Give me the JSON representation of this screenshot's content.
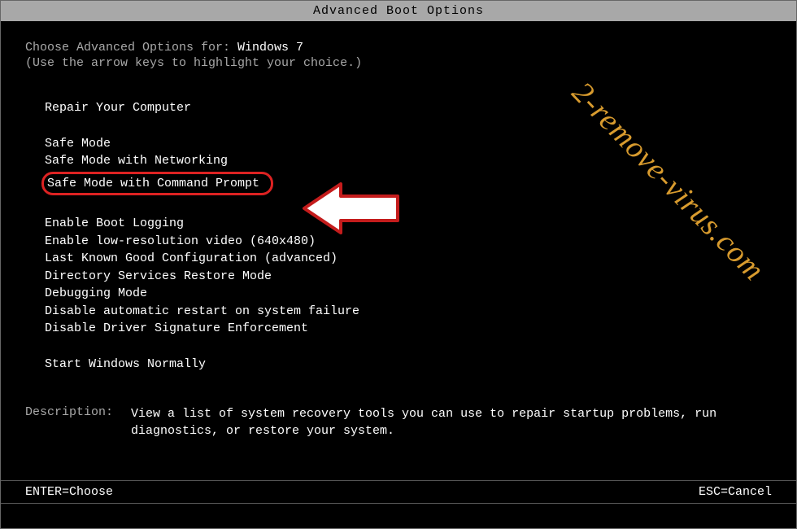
{
  "header": {
    "title": "Advanced Boot Options"
  },
  "prompt": {
    "prefix": "Choose Advanced Options for: ",
    "os": "Windows 7",
    "hint": "(Use the arrow keys to highlight your choice.)"
  },
  "menu": {
    "section1": [
      "Repair Your Computer"
    ],
    "section2": [
      "Safe Mode",
      "Safe Mode with Networking",
      "Safe Mode with Command Prompt"
    ],
    "section3": [
      "Enable Boot Logging",
      "Enable low-resolution video (640x480)",
      "Last Known Good Configuration (advanced)",
      "Directory Services Restore Mode",
      "Debugging Mode",
      "Disable automatic restart on system failure",
      "Disable Driver Signature Enforcement"
    ],
    "section4": [
      "Start Windows Normally"
    ]
  },
  "description": {
    "label": "Description:",
    "text": "View a list of system recovery tools you can use to repair startup problems, run diagnostics, or restore your system."
  },
  "footer": {
    "left": "ENTER=Choose",
    "right": "ESC=Cancel"
  },
  "watermark": "2-remove-virus.com"
}
